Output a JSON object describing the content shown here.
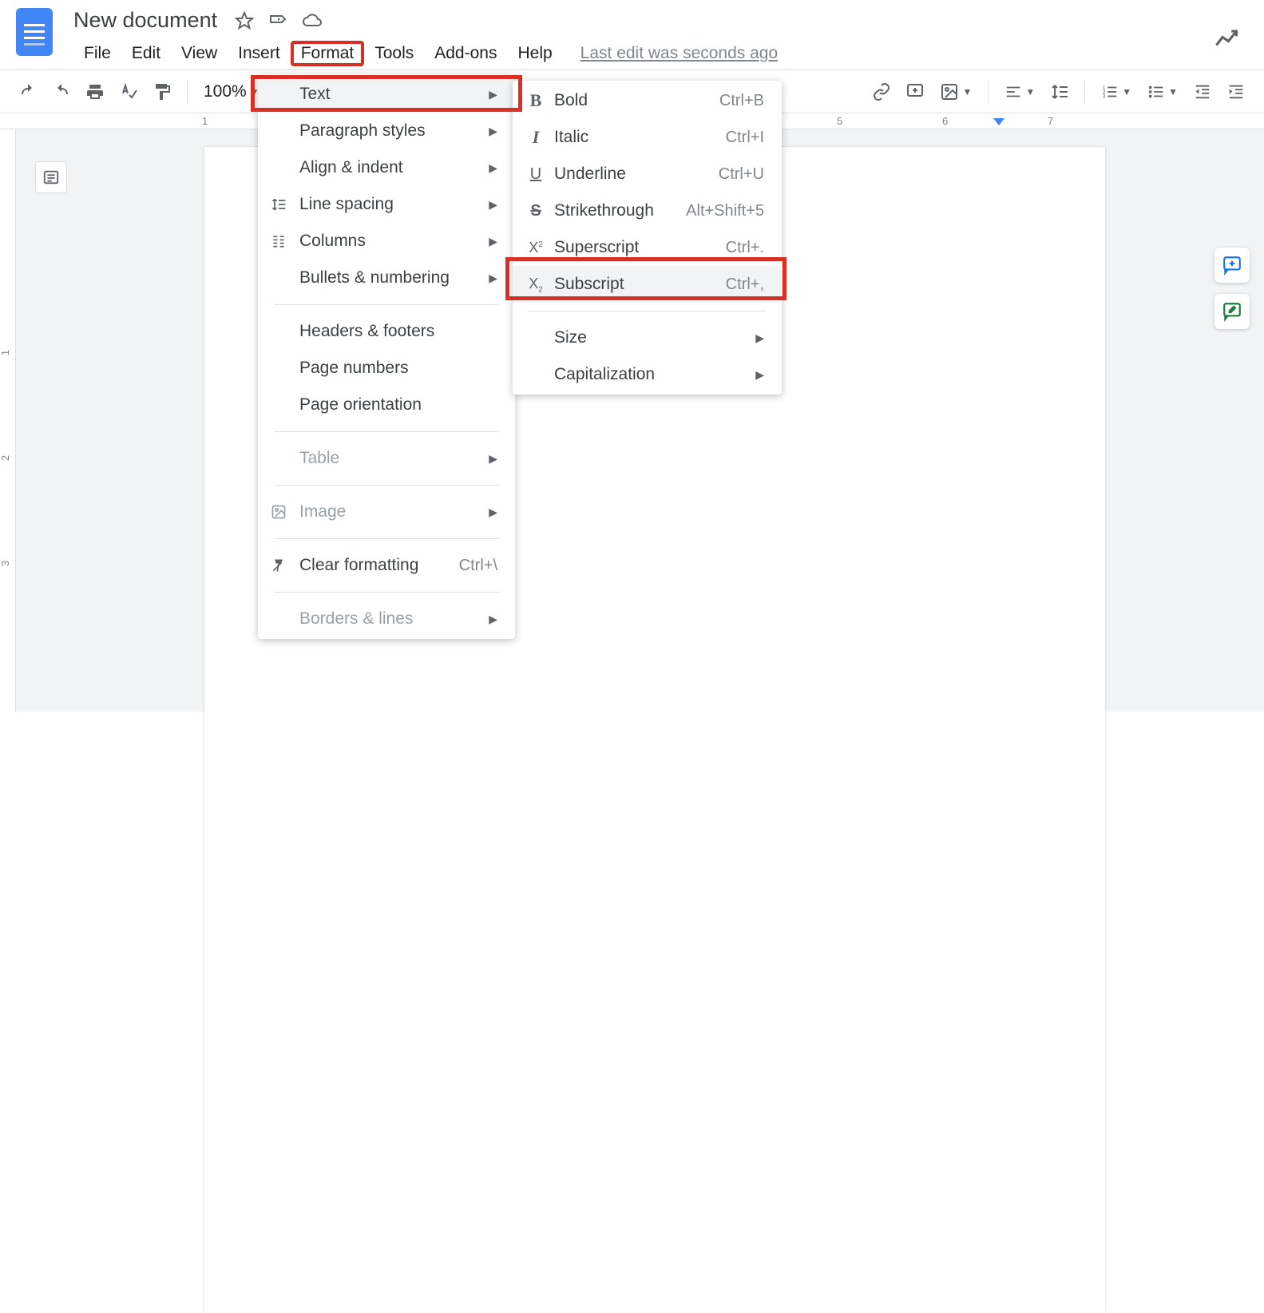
{
  "header": {
    "doc_title": "New document",
    "menus": [
      "File",
      "Edit",
      "View",
      "Insert",
      "Format",
      "Tools",
      "Add-ons",
      "Help"
    ],
    "active_menu_index": 4,
    "last_edit": "Last edit was seconds ago"
  },
  "toolbar": {
    "zoom": "100%"
  },
  "ruler": {
    "h_numbers": [
      "1",
      "5",
      "6",
      "7"
    ],
    "v_numbers": [
      "1",
      "2",
      "3"
    ]
  },
  "format_menu": {
    "items": [
      {
        "label": "Text",
        "arrow": true,
        "hover": true,
        "icon": ""
      },
      {
        "label": "Paragraph styles",
        "arrow": true,
        "icon": ""
      },
      {
        "label": "Align & indent",
        "arrow": true,
        "icon": ""
      },
      {
        "label": "Line spacing",
        "arrow": true,
        "icon": "line-spacing"
      },
      {
        "label": "Columns",
        "arrow": true,
        "icon": "columns"
      },
      {
        "label": "Bullets & numbering",
        "arrow": true,
        "icon": ""
      },
      {
        "sep": true
      },
      {
        "label": "Headers & footers",
        "icon": ""
      },
      {
        "label": "Page numbers",
        "icon": ""
      },
      {
        "label": "Page orientation",
        "icon": ""
      },
      {
        "sep": true
      },
      {
        "label": "Table",
        "arrow": true,
        "disabled": true,
        "icon": ""
      },
      {
        "sep": true
      },
      {
        "label": "Image",
        "arrow": true,
        "disabled": true,
        "icon": "image"
      },
      {
        "sep": true
      },
      {
        "label": "Clear formatting",
        "icon": "clear",
        "shortcut": "Ctrl+\\"
      },
      {
        "sep": true
      },
      {
        "label": "Borders & lines",
        "arrow": true,
        "disabled": true,
        "icon": ""
      }
    ]
  },
  "text_submenu": {
    "items": [
      {
        "label": "Bold",
        "icon": "B",
        "shortcut": "Ctrl+B"
      },
      {
        "label": "Italic",
        "icon": "I",
        "shortcut": "Ctrl+I"
      },
      {
        "label": "Underline",
        "icon": "U",
        "shortcut": "Ctrl+U"
      },
      {
        "label": "Strikethrough",
        "icon": "S",
        "shortcut": "Alt+Shift+5"
      },
      {
        "label": "Superscript",
        "icon": "X²",
        "shortcut": "Ctrl+."
      },
      {
        "label": "Subscript",
        "icon": "X₂",
        "shortcut": "Ctrl+,",
        "hover": true
      },
      {
        "sep": true
      },
      {
        "label": "Size",
        "arrow": true
      },
      {
        "label": "Capitalization",
        "arrow": true
      }
    ]
  }
}
